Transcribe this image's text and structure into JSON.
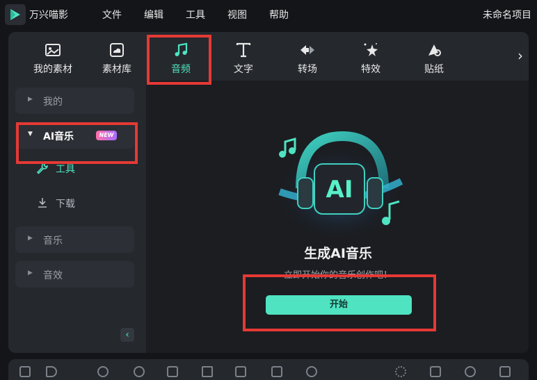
{
  "app": {
    "name": "万兴喵影",
    "project_name": "未命名项目"
  },
  "menu": [
    "文件",
    "编辑",
    "工具",
    "视图",
    "帮助"
  ],
  "toolbar": {
    "tabs": [
      {
        "label": "我的素材",
        "icon": "image-icon"
      },
      {
        "label": "素材库",
        "icon": "cloud-image-icon"
      },
      {
        "label": "音频",
        "icon": "music-note-icon",
        "active": true
      },
      {
        "label": "文字",
        "icon": "text-icon"
      },
      {
        "label": "转场",
        "icon": "transition-icon"
      },
      {
        "label": "特效",
        "icon": "effects-icon"
      },
      {
        "label": "贴纸",
        "icon": "sticker-icon"
      }
    ],
    "more_icon": "chevron-right-icon"
  },
  "sidebar": {
    "sections": [
      {
        "label": "我的",
        "open": false
      },
      {
        "label": "AI音乐",
        "open": true,
        "badge": "NEW"
      },
      {
        "label": "音乐",
        "open": false
      },
      {
        "label": "音效",
        "open": false
      }
    ],
    "sub_items": [
      {
        "label": "工具",
        "icon": "wrench-icon",
        "active": true
      },
      {
        "label": "下载",
        "icon": "download-icon",
        "active": false
      }
    ],
    "collapse_icon": "chevron-left-icon"
  },
  "content": {
    "title": "生成AI音乐",
    "subtitle": "立即开始你的音乐创作吧！",
    "start_button": "开始",
    "hero_text": "AI"
  },
  "colors": {
    "accent": "#4fe3c1",
    "highlight": "#e53935",
    "badge_from": "#ff6fa8",
    "badge_to": "#a86cff"
  }
}
